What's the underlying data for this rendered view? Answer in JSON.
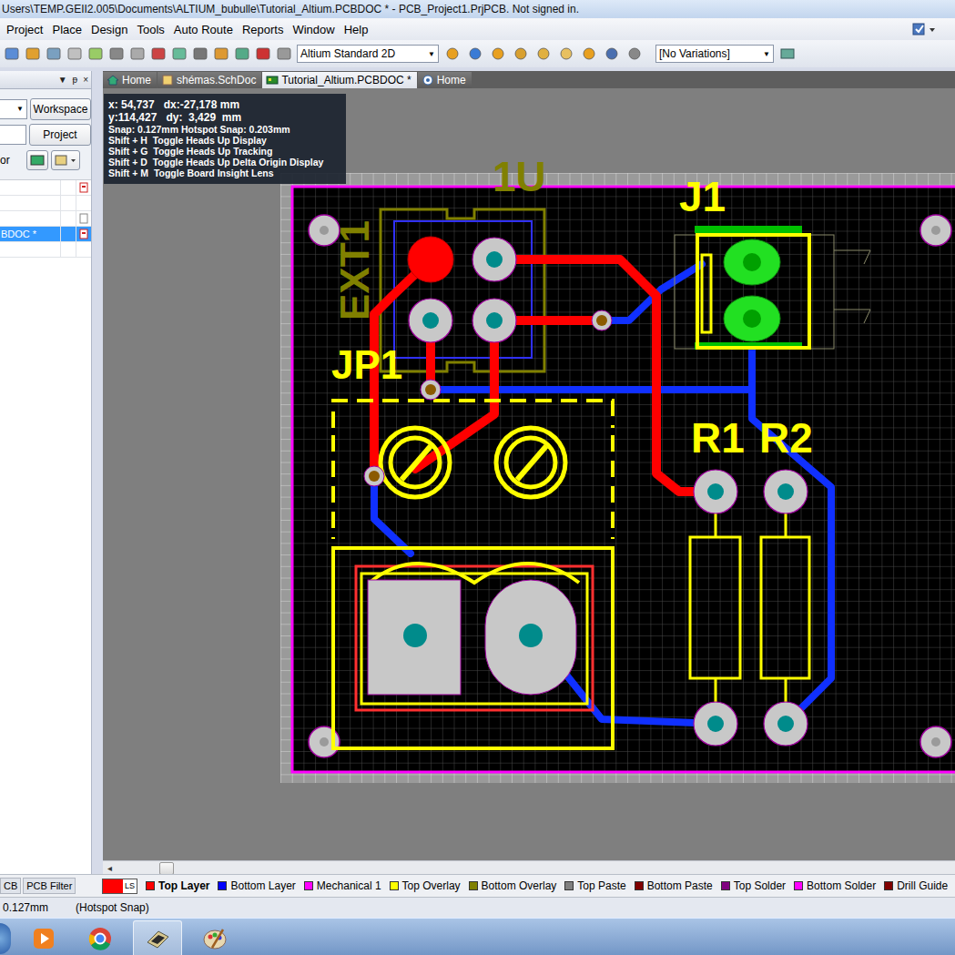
{
  "window": {
    "title": "Users\\TEMP.GEII2.005\\Documents\\ALTIUM_bubulle\\Tutorial_Altium.PCBDOC * - PCB_Project1.PrjPCB. Not signed in."
  },
  "menu": [
    "Project",
    "Place",
    "Design",
    "Tools",
    "Auto Route",
    "Reports",
    "Window",
    "Help"
  ],
  "toolbar": {
    "view_config": "Altium Standard 2D",
    "variations": "[No Variations]",
    "dropdown_arrow": "▼"
  },
  "left_panel": {
    "controls": [
      "▼",
      "ᵽ",
      "×"
    ],
    "select_arrow": "▼",
    "buttons": [
      "Workspace",
      "Project"
    ],
    "label": "or",
    "files": [
      {
        "label": "",
        "selected": false,
        "kind": "pdf"
      },
      {
        "label": "",
        "selected": false,
        "kind": "blank"
      },
      {
        "label": "",
        "selected": false,
        "kind": "doc"
      },
      {
        "label": "BDOC *",
        "selected": true,
        "kind": "pdf"
      },
      {
        "label": "",
        "selected": false,
        "kind": "blank"
      }
    ],
    "bottom_tabs": [
      {
        "label": "CB",
        "selected": false
      },
      {
        "label": "PCB Filter",
        "selected": false
      }
    ]
  },
  "editor_tabs": [
    {
      "label": "Home",
      "selected": false,
      "kind": "home"
    },
    {
      "label": "shémas.SchDoc",
      "selected": false,
      "kind": "sch"
    },
    {
      "label": "Tutorial_Altium.PCBDOC *",
      "selected": true,
      "kind": "pcb"
    },
    {
      "label": "Home",
      "selected": false,
      "kind": "web"
    }
  ],
  "hud": {
    "lines": [
      "x: 54,737   dx:-27,178 mm",
      "y:114,427   dy:  3,429  mm",
      "Snap: 0.127mm Hotspot Snap: 0.203mm",
      "Shift + H  Toggle Heads Up Display",
      "Shift + G  Toggle Heads Up Tracking",
      "Shift + D  Toggle Heads Up Delta Origin Display",
      "Shift + M  Toggle Board Insight Lens"
    ]
  },
  "board": {
    "designators": [
      {
        "text": "1U",
        "color": "#808000"
      },
      {
        "text": "EXT1",
        "color": "#808000"
      },
      {
        "text": "J1",
        "color": "#ffff00"
      },
      {
        "text": "JP1",
        "color": "#ffff00"
      },
      {
        "text": "R1",
        "color": "#ffff00"
      },
      {
        "text": "R2",
        "color": "#ffff00"
      }
    ]
  },
  "scroll_arrow": "◂",
  "layers": {
    "current": "LS",
    "current_color": "#ff0000",
    "items": [
      {
        "label": "Top Layer",
        "color": "#ff0000",
        "selected": true
      },
      {
        "label": "Bottom Layer",
        "color": "#0000ff",
        "selected": false
      },
      {
        "label": "Mechanical 1",
        "color": "#ff00ff",
        "selected": false
      },
      {
        "label": "Top Overlay",
        "color": "#ffff00",
        "selected": false
      },
      {
        "label": "Bottom Overlay",
        "color": "#808000",
        "selected": false
      },
      {
        "label": "Top Paste",
        "color": "#808080",
        "selected": false
      },
      {
        "label": "Bottom Paste",
        "color": "#800000",
        "selected": false
      },
      {
        "label": "Top Solder",
        "color": "#800080",
        "selected": false
      },
      {
        "label": "Bottom Solder",
        "color": "#ff00ff",
        "selected": false
      },
      {
        "label": "Drill Guide",
        "color": "#800000",
        "selected": false
      }
    ]
  },
  "status_bar": [
    "0.127mm",
    "(Hotspot Snap)"
  ]
}
